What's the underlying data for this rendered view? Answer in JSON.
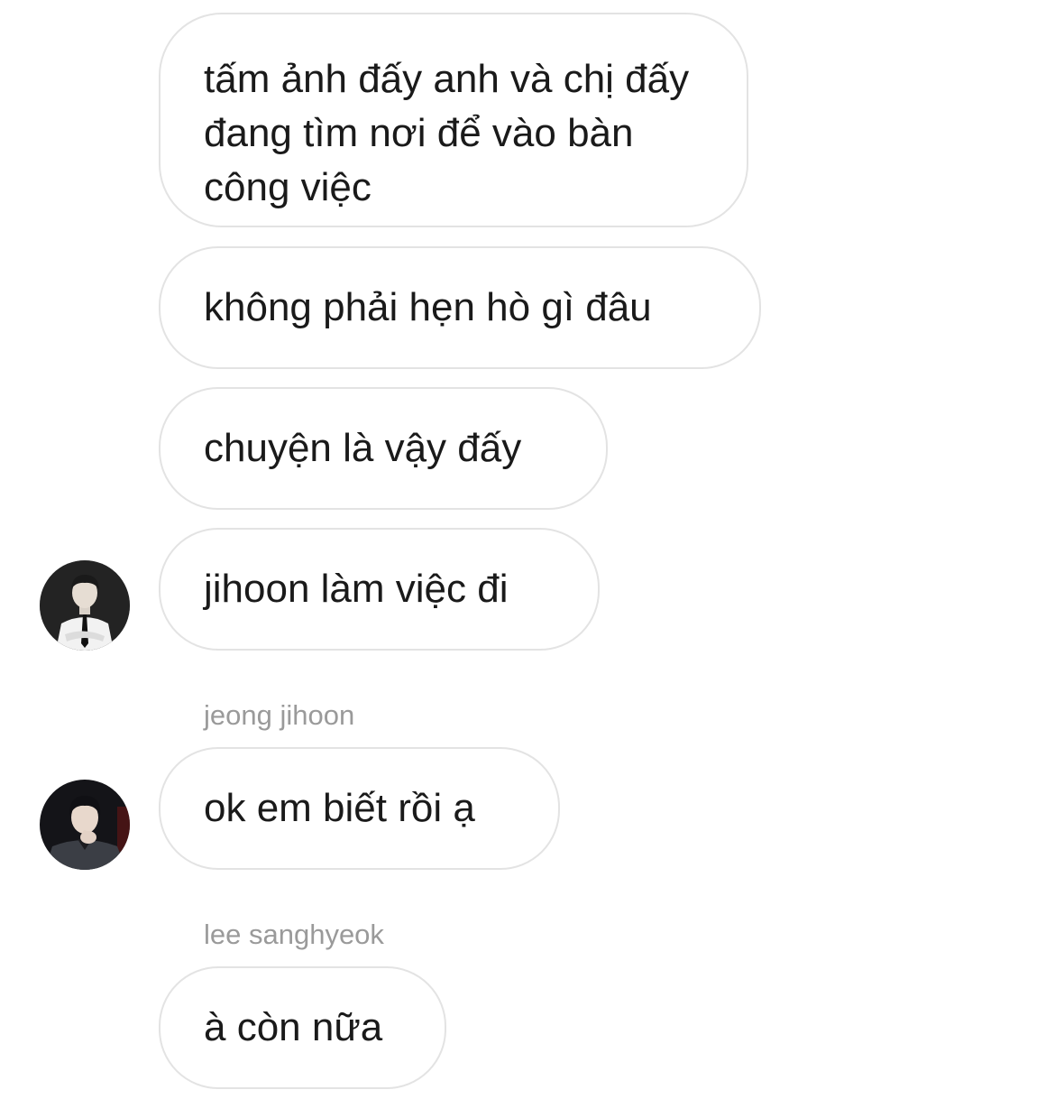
{
  "thread": {
    "messages": [
      {
        "id": "m1",
        "text": "tấm ảnh đấy anh và chị đấy đang tìm nơi để vào bàn công việc"
      },
      {
        "id": "m2",
        "text": "không phải hẹn hò gì đâu"
      },
      {
        "id": "m3",
        "text": "chuyện là vậy đấy"
      },
      {
        "id": "m4",
        "text": "jihoon làm việc đi"
      },
      {
        "id": "m5",
        "text": "ok em biết rồi ạ",
        "sender": "jeong jihoon"
      },
      {
        "id": "m6",
        "text": "à còn nữa",
        "sender": "lee sanghyeok"
      }
    ]
  },
  "avatars": [
    {
      "for_message": "m4",
      "icon": "profile-photo-man-white-shirt-tie",
      "bg_color": "#1c1c1c"
    },
    {
      "for_message": "m5",
      "icon": "profile-photo-man-dark-suit",
      "bg_color": "#141418"
    }
  ],
  "colors": {
    "bubble_border": "#e3e3e3",
    "bubble_text": "#1a1a1a",
    "sender_text": "#9a9a9a",
    "background": "#ffffff"
  }
}
